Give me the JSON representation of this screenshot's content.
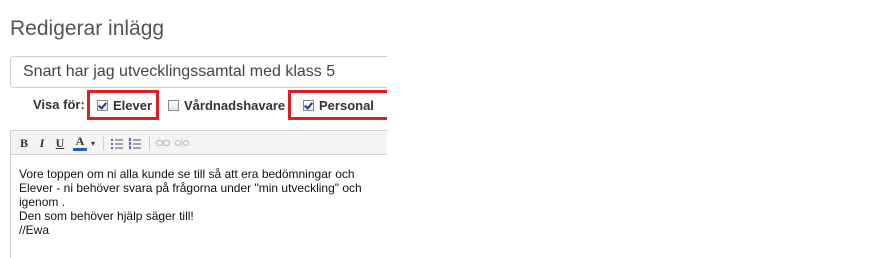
{
  "page": {
    "title": "Redigerar inlägg"
  },
  "subject": {
    "value": "Snart har jag utvecklingssamtal med klass 5"
  },
  "visibility": {
    "label": "Visa för:",
    "options": [
      {
        "label": "Elever",
        "checked": true
      },
      {
        "label": "Vårdnadshavare",
        "checked": false
      },
      {
        "label": "Personal",
        "checked": true
      }
    ]
  },
  "toolbar": {
    "bold_label": "B",
    "italic_label": "I",
    "underline_label": "U",
    "font_color_label": "A",
    "buttons": [
      "bold-icon",
      "italic-icon",
      "underline-icon",
      "font-color-icon",
      "bullet-list-icon",
      "numbered-list-icon",
      "link-icon",
      "unlink-icon"
    ]
  },
  "editor": {
    "lines": [
      "Vore toppen om ni alla kunde se till så att era bedömningar och",
      "Elever - ni behöver svara på frågorna under \"min utveckling\" och",
      "igenom .",
      "Den som behöver hjälp säger till!",
      "//Ewa"
    ]
  },
  "colors": {
    "highlight": "#e02020",
    "font_color_accent": "#1f5fbf"
  }
}
